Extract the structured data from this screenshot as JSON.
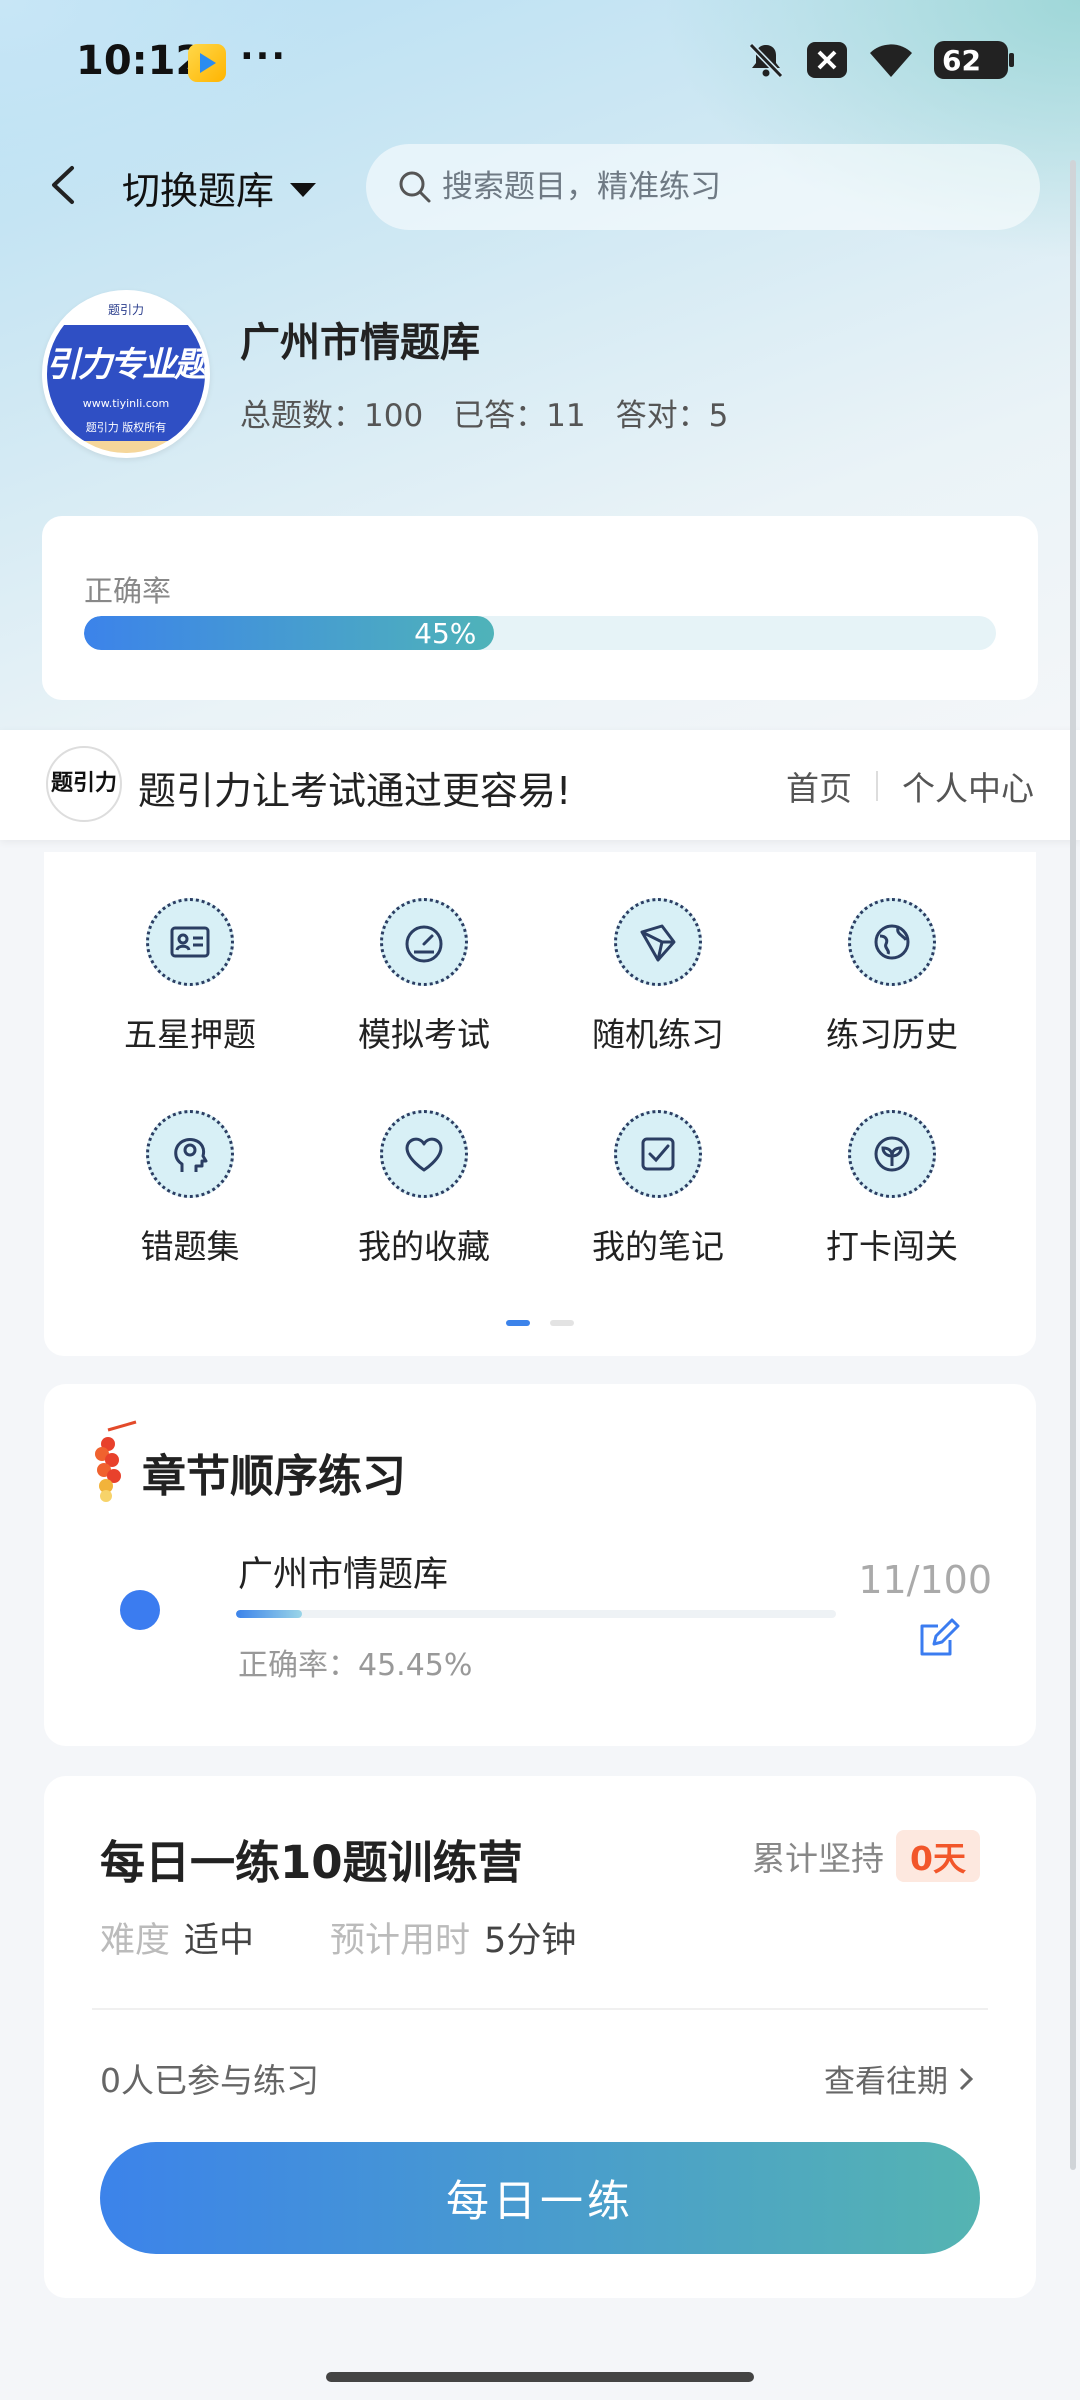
{
  "status_bar": {
    "time": "10:12",
    "more": "···",
    "battery": "62"
  },
  "nav": {
    "switch_label": "切换题库",
    "search_placeholder": "搜索题目，精准练习"
  },
  "library": {
    "title": "广州市情题库",
    "logo_text": "引力专业题",
    "logo_url": "www.tiyinli.com",
    "logo_sub": "题引力 版权所有",
    "stats": {
      "total": "总题数：100",
      "answered": "已答：11",
      "correct": "答对：5"
    }
  },
  "accuracy": {
    "label": "正确率",
    "percent": 45,
    "percent_text": "45%"
  },
  "brand": {
    "logo_text": "题引力",
    "slogan": "题引力让考试通过更容易!",
    "home": "首页",
    "profile": "个人中心"
  },
  "features": [
    {
      "label": "五星押题",
      "icon": "id-card-icon"
    },
    {
      "label": "模拟考试",
      "icon": "gauge-icon"
    },
    {
      "label": "随机练习",
      "icon": "random-icon"
    },
    {
      "label": "练习历史",
      "icon": "globe-icon"
    },
    {
      "label": "错题集",
      "icon": "head-icon"
    },
    {
      "label": "我的收藏",
      "icon": "heart-icon"
    },
    {
      "label": "我的笔记",
      "icon": "note-icon"
    },
    {
      "label": "打卡闯关",
      "icon": "sprout-icon"
    }
  ],
  "pager": {
    "current": 0,
    "total": 2
  },
  "chapter": {
    "title": "章节顺序练习",
    "item_name": "广州市情题库",
    "progress_fraction": 0.11,
    "count": "11/100",
    "accuracy": "正确率：45.45%"
  },
  "daily": {
    "title": "每日一练10题训练营",
    "streak_label": "累计坚持",
    "streak_days": "0天",
    "difficulty_label": "难度",
    "difficulty_value": "适中",
    "time_label": "预计用时",
    "time_value": "5分钟",
    "joined": "0人已参与练习",
    "history": "查看往期",
    "button": "每日一练"
  },
  "colors": {
    "accent": "#3c83ea",
    "accent_teal": "#4fb3b9",
    "streak": "#f2562a"
  }
}
